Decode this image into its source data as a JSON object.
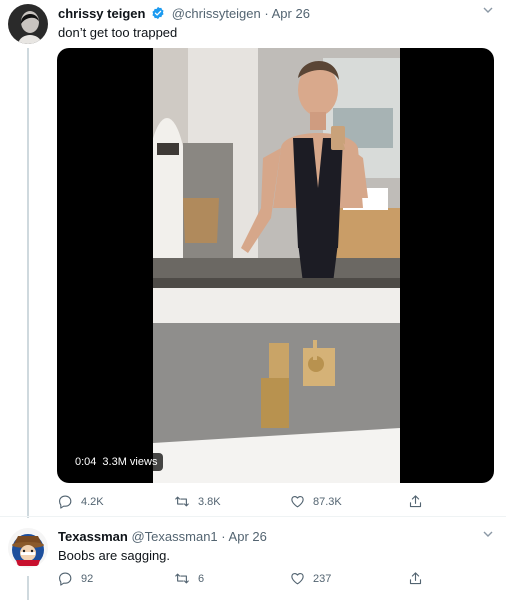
{
  "tweet1": {
    "display_name": "chrissy teigen",
    "handle": "@chrissyteigen",
    "separator": "·",
    "date": "Apr 26",
    "text": "don’t get too trapped",
    "video": {
      "time": "0:04",
      "views": "3.3M views"
    },
    "actions": {
      "replies": "4.2K",
      "retweets": "3.8K",
      "likes": "87.3K"
    }
  },
  "tweet2": {
    "display_name": "Texassman",
    "handle": "@Texassman1",
    "separator": "·",
    "date": "Apr 26",
    "text": "Boobs are sagging.",
    "actions": {
      "replies": "92",
      "retweets": "6",
      "likes": "237"
    }
  },
  "colors": {
    "verified": "#1d9bf0",
    "meta": "#536471",
    "thread_line": "#cfd9de"
  }
}
